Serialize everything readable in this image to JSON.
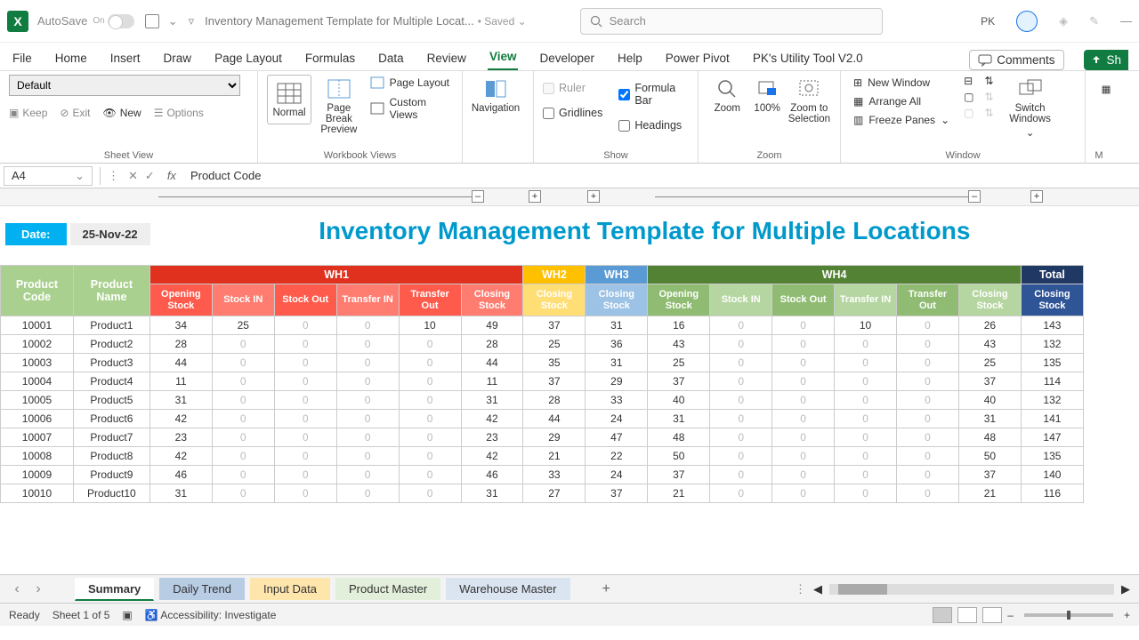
{
  "titlebar": {
    "autosave_label": "AutoSave",
    "autosave_on": "On",
    "doc_title": "Inventory Management Template for Multiple Locat...",
    "saved_state": "• Saved ⌄",
    "search_placeholder": "Search",
    "user_initials": "PK"
  },
  "menu": {
    "tabs": [
      "File",
      "Home",
      "Insert",
      "Draw",
      "Page Layout",
      "Formulas",
      "Data",
      "Review",
      "View",
      "Developer",
      "Help",
      "Power Pivot",
      "PK's Utility Tool V2.0"
    ],
    "active": "View",
    "comments": "Comments",
    "share": "Sh"
  },
  "ribbon": {
    "sheet_view": {
      "default": "Default",
      "keep": "Keep",
      "exit": "Exit",
      "new": "New",
      "options": "Options",
      "label": "Sheet View"
    },
    "workbook_views": {
      "normal": "Normal",
      "pagebreak": "Page Break Preview",
      "pagelayout": "Page Layout",
      "custom": "Custom Views",
      "label": "Workbook Views"
    },
    "navigation": {
      "btn": "Navigation"
    },
    "show": {
      "ruler": "Ruler",
      "formula": "Formula Bar",
      "gridlines": "Gridlines",
      "headings": "Headings",
      "label": "Show"
    },
    "zoom": {
      "zoom": "Zoom",
      "p100": "100%",
      "sel": "Zoom to Selection",
      "label": "Zoom"
    },
    "window": {
      "neww": "New Window",
      "arrange": "Arrange All",
      "freeze": "Freeze Panes",
      "switch": "Switch Windows",
      "label": "Window"
    },
    "macros": {
      "label": "M"
    }
  },
  "formula_bar": {
    "cell": "A4",
    "content": "Product Code"
  },
  "sheet": {
    "date_label": "Date:",
    "date_value": "25-Nov-22",
    "title": "Inventory Management Template for Multiple Locations",
    "wh_headers": [
      "WH1",
      "WH2",
      "WH3",
      "WH4",
      "Total"
    ],
    "sub": {
      "open": "Opening Stock",
      "in": "Stock IN",
      "out": "Stock Out",
      "tin": "Transfer IN",
      "tout": "Transfer Out",
      "close": "Closing Stock"
    },
    "cols": [
      "Product Code",
      "Product Name"
    ],
    "rows": [
      {
        "code": "10001",
        "name": "Product1",
        "wh1": [
          34,
          25,
          0,
          0,
          10,
          49
        ],
        "wh2": 37,
        "wh3": 31,
        "wh4": [
          16,
          0,
          0,
          10,
          0,
          26
        ],
        "total": 143
      },
      {
        "code": "10002",
        "name": "Product2",
        "wh1": [
          28,
          0,
          0,
          0,
          0,
          28
        ],
        "wh2": 25,
        "wh3": 36,
        "wh4": [
          43,
          0,
          0,
          0,
          0,
          43
        ],
        "total": 132
      },
      {
        "code": "10003",
        "name": "Product3",
        "wh1": [
          44,
          0,
          0,
          0,
          0,
          44
        ],
        "wh2": 35,
        "wh3": 31,
        "wh4": [
          25,
          0,
          0,
          0,
          0,
          25
        ],
        "total": 135
      },
      {
        "code": "10004",
        "name": "Product4",
        "wh1": [
          11,
          0,
          0,
          0,
          0,
          11
        ],
        "wh2": 37,
        "wh3": 29,
        "wh4": [
          37,
          0,
          0,
          0,
          0,
          37
        ],
        "total": 114
      },
      {
        "code": "10005",
        "name": "Product5",
        "wh1": [
          31,
          0,
          0,
          0,
          0,
          31
        ],
        "wh2": 28,
        "wh3": 33,
        "wh4": [
          40,
          0,
          0,
          0,
          0,
          40
        ],
        "total": 132
      },
      {
        "code": "10006",
        "name": "Product6",
        "wh1": [
          42,
          0,
          0,
          0,
          0,
          42
        ],
        "wh2": 44,
        "wh3": 24,
        "wh4": [
          31,
          0,
          0,
          0,
          0,
          31
        ],
        "total": 141
      },
      {
        "code": "10007",
        "name": "Product7",
        "wh1": [
          23,
          0,
          0,
          0,
          0,
          23
        ],
        "wh2": 29,
        "wh3": 47,
        "wh4": [
          48,
          0,
          0,
          0,
          0,
          48
        ],
        "total": 147
      },
      {
        "code": "10008",
        "name": "Product8",
        "wh1": [
          42,
          0,
          0,
          0,
          0,
          42
        ],
        "wh2": 21,
        "wh3": 22,
        "wh4": [
          50,
          0,
          0,
          0,
          0,
          50
        ],
        "total": 135
      },
      {
        "code": "10009",
        "name": "Product9",
        "wh1": [
          46,
          0,
          0,
          0,
          0,
          46
        ],
        "wh2": 33,
        "wh3": 24,
        "wh4": [
          37,
          0,
          0,
          0,
          0,
          37
        ],
        "total": 140
      },
      {
        "code": "10010",
        "name": "Product10",
        "wh1": [
          31,
          0,
          0,
          0,
          0,
          31
        ],
        "wh2": 27,
        "wh3": 37,
        "wh4": [
          21,
          0,
          0,
          0,
          0,
          21
        ],
        "total": 116
      }
    ]
  },
  "sheet_tabs": [
    "Summary",
    "Daily Trend",
    "Input Data",
    "Product Master",
    "Warehouse Master"
  ],
  "status": {
    "ready": "Ready",
    "sheet": "Sheet 1 of 5",
    "access": "Accessibility: Investigate",
    "zoom": "100%"
  }
}
